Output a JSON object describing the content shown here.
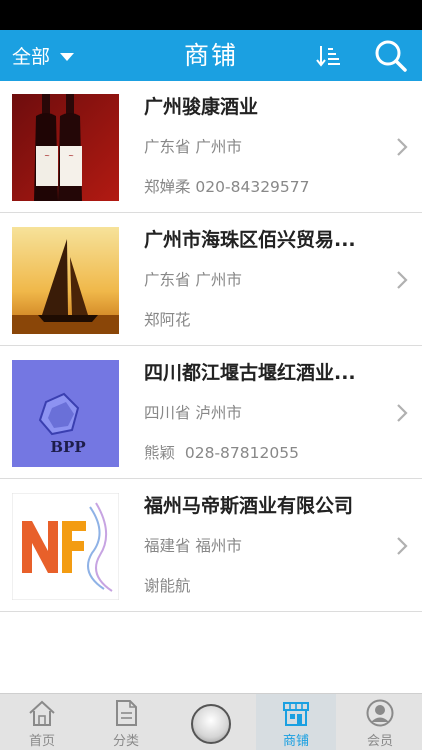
{
  "header": {
    "filter_label": "全部",
    "title": "商铺"
  },
  "shops": [
    {
      "name": "广州骏康酒业",
      "region": "广东省 广州市",
      "contact": "郑婵柔 020-84329577",
      "thumb": "wine-bottles"
    },
    {
      "name": "广州市海珠区佰兴贸易...",
      "region": "广东省 广州市",
      "contact": "郑阿花",
      "thumb": "sailboat-sunset"
    },
    {
      "name": "四川都江堰古堰红酒业...",
      "region": "四川省 泸州市",
      "contact": "熊颖  028-87812055",
      "thumb": "bpp-logo"
    },
    {
      "name": "福州马帝斯酒业有限公司",
      "region": "福建省 福州市",
      "contact": "谢能航",
      "thumb": "nf-logo"
    }
  ],
  "tabbar": {
    "tabs": [
      {
        "label": "首页",
        "icon": "house-icon"
      },
      {
        "label": "分类",
        "icon": "document-icon"
      },
      {
        "label": "商铺",
        "icon": "store-icon",
        "active": true
      },
      {
        "label": "会员",
        "icon": "person-icon"
      }
    ]
  },
  "colors": {
    "accent": "#1ba0e1"
  }
}
